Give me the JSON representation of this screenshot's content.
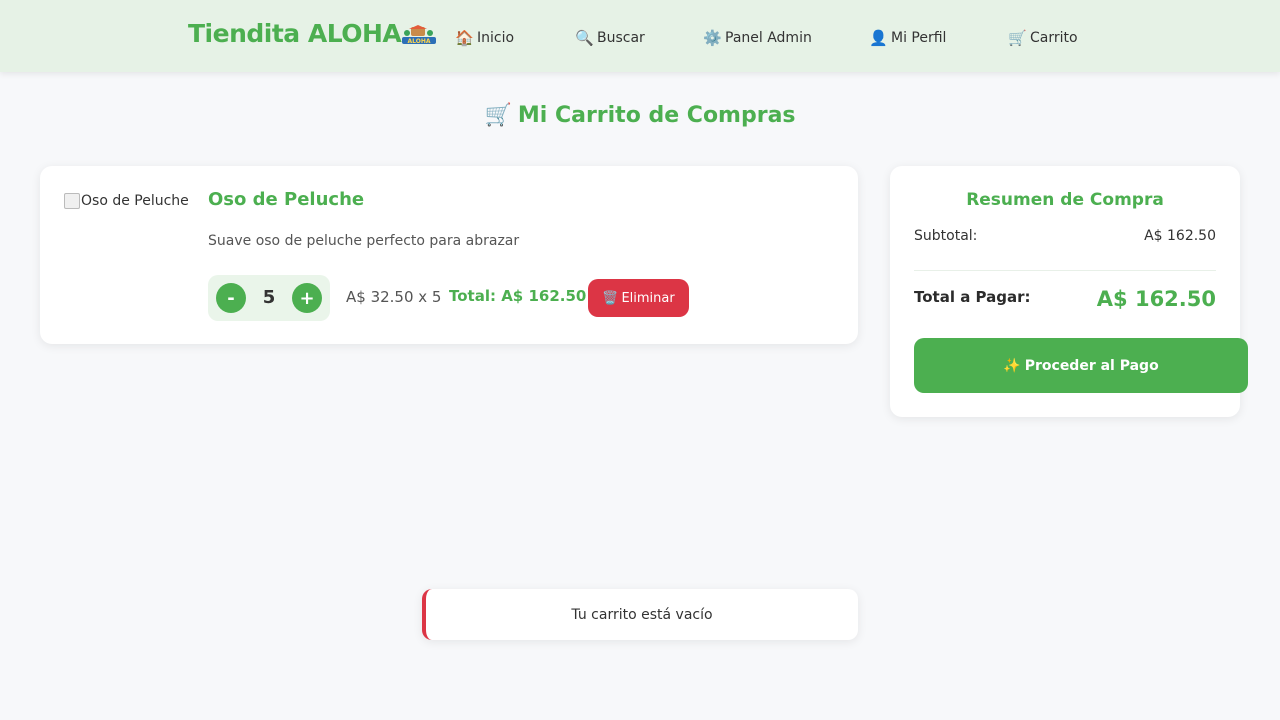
{
  "header": {
    "brand": "Tiendita ALOHA",
    "logo_icon": "aloha-logo",
    "nav": [
      {
        "icon": "🏠",
        "label": "Inicio"
      },
      {
        "icon": "🔍",
        "label": "Buscar"
      },
      {
        "icon": "⚙️",
        "label": "Panel Admin"
      },
      {
        "icon": "👤",
        "label": "Mi Perfil"
      },
      {
        "icon": "🛒",
        "label": "Carrito"
      }
    ]
  },
  "page": {
    "title_icon": "🛒",
    "title": "Mi Carrito de Compras"
  },
  "cart": {
    "items": [
      {
        "image_alt": "Oso de Peluche",
        "name": "Oso de Peluche",
        "description": "Suave oso de peluche perfecto para abrazar",
        "minus_label": "-",
        "quantity": "5",
        "plus_label": "+",
        "unit_price": "A$ 32.50 x 5",
        "line_total": "Total: A$ 162.50",
        "delete_icon": "🗑️",
        "delete_label": "Eliminar"
      }
    ],
    "empty_message": "Tu carrito está vacío"
  },
  "summary": {
    "title": "Resumen de Compra",
    "subtotal_label": "Subtotal:",
    "subtotal_value": "A$ 162.50",
    "total_label": "Total a Pagar:",
    "total_value": "A$ 162.50",
    "pay_icon": "✨",
    "pay_label": "Proceder al Pago"
  },
  "colors": {
    "accent": "#4caf50",
    "header_bg": "#e6f2e6",
    "danger": "#dc3545",
    "page_bg": "#f7f8fa"
  }
}
